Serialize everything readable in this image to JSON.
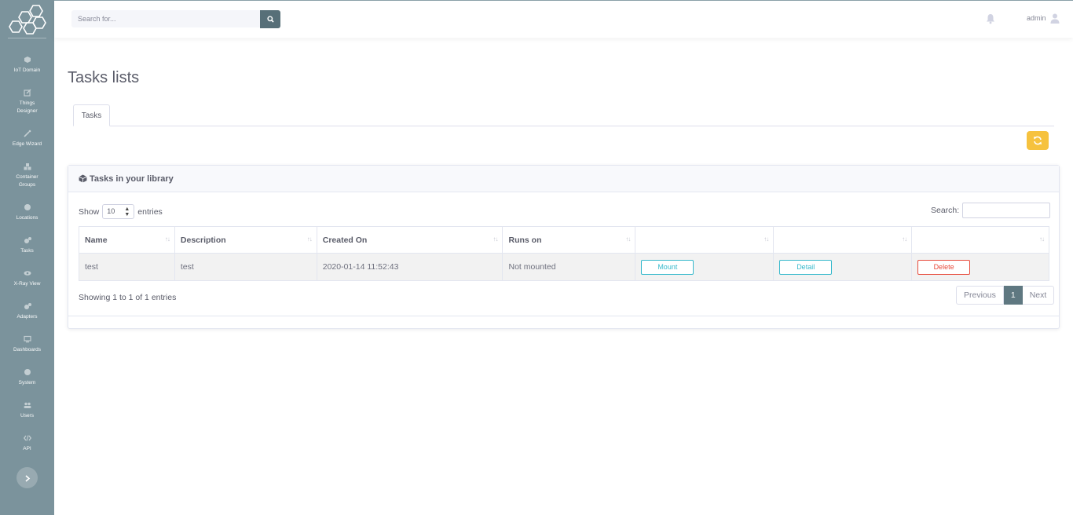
{
  "colors": {
    "sidebar": "#7b939c",
    "accent": "#576f78",
    "warning": "#f6c23e",
    "info": "#36b9cc",
    "danger": "#e74a3b"
  },
  "sidebar": {
    "logo_icon": "hexagon-logo",
    "items": [
      {
        "label": "IoT Domain",
        "icon": "cube-icon"
      },
      {
        "label": "Things Designer",
        "icon": "edit-icon"
      },
      {
        "label": "Edge Wizard",
        "icon": "magic-icon"
      },
      {
        "label": "Container Groups",
        "icon": "cubes-icon"
      },
      {
        "label": "Locations",
        "icon": "globe-icon"
      },
      {
        "label": "Tasks",
        "icon": "cogs-icon"
      },
      {
        "label": "X-Ray View",
        "icon": "eye-icon"
      },
      {
        "label": "Adapters",
        "icon": "cogs-icon"
      },
      {
        "label": "Dashboards",
        "icon": "desktop-icon"
      },
      {
        "label": "System",
        "icon": "globe-icon"
      },
      {
        "label": "Users",
        "icon": "users-icon"
      },
      {
        "label": "API",
        "icon": "code-icon"
      }
    ],
    "toggle_icon": "chevron-right-icon"
  },
  "topbar": {
    "search_placeholder": "Search for...",
    "search_icon": "search-icon",
    "bell_icon": "bell-icon",
    "user_name": "admin",
    "user_icon": "user-icon"
  },
  "main": {
    "title": "Tasks lists",
    "tabs": [
      {
        "label": "Tasks"
      }
    ],
    "refresh_icon": "refresh-icon"
  },
  "card": {
    "title": "Tasks in your library",
    "header_icon": "cube-icon",
    "length": {
      "prefix": "Show",
      "value": "10",
      "suffix": "entries"
    },
    "filter_label": "Search:",
    "columns": [
      "Name",
      "Description",
      "Created On",
      "Runs on",
      "",
      "",
      ""
    ],
    "rows": [
      {
        "name": "test",
        "description": "test",
        "created_on": "2020-01-14 11:52:43",
        "runs_on": "Not mounted",
        "mount": "Mount",
        "detail": "Detail",
        "delete": "Delete"
      }
    ],
    "info": "Showing 1 to 1 of 1 entries",
    "pagination": {
      "previous": "Previous",
      "current": "1",
      "next": "Next"
    }
  }
}
